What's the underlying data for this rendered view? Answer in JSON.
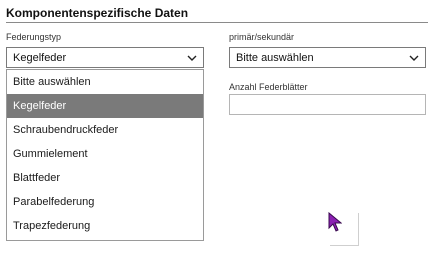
{
  "section": {
    "title": "Komponentenspezifische Daten"
  },
  "left": {
    "label": "Federungstyp",
    "selected_value": "Kegelfeder",
    "options": [
      "Bitte auswählen",
      "Kegelfeder",
      "Schraubendruckfeder",
      "Gummielement",
      "Blattfeder",
      "Parabelfederung",
      "Trapezfederung"
    ],
    "selected_index": 1
  },
  "right": {
    "mode_label": "primär/sekundär",
    "mode_value": "Bitte auswählen",
    "leaves_label": "Anzahl Federblätter",
    "leaves_value": ""
  },
  "icons": {
    "dropdown": "chevron-down-icon",
    "cursor": "mouse-pointer-icon"
  },
  "colors": {
    "selected_bg": "#7a7a7a",
    "cursor": "#8b1fb3"
  }
}
